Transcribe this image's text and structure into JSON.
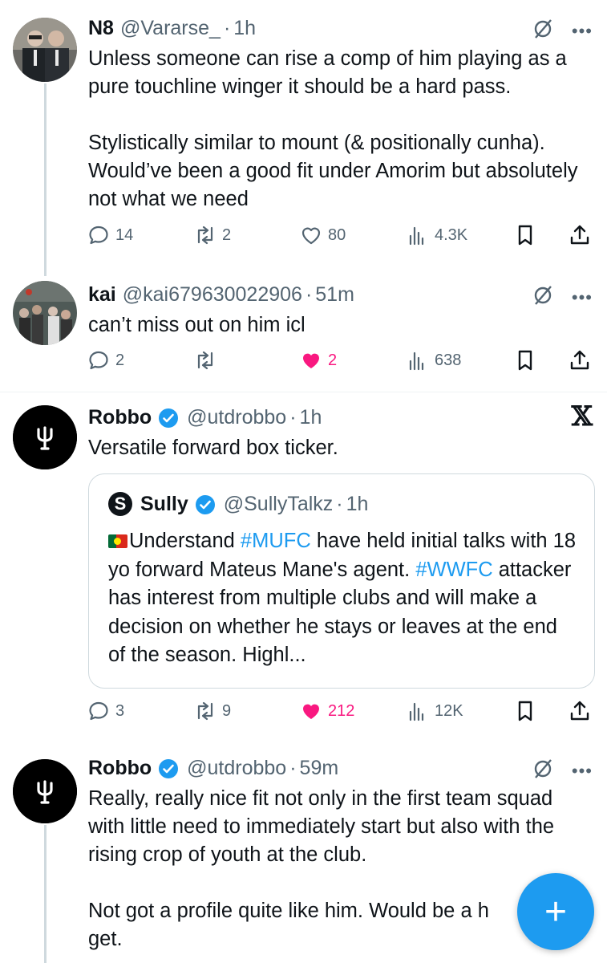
{
  "tweets": [
    {
      "name": "N8",
      "handle": "@Vararse_",
      "dot": "·",
      "time": "1h",
      "paragraphs": [
        "Unless someone can rise a comp of him playing as a pure touchline winger it should be a hard pass.",
        "Stylistically similar to mount (& positionally cunha). Would’ve been a good fit under Amorim but absolutely not what we need"
      ],
      "replies": "14",
      "retweets": "2",
      "likes": "80",
      "views": "4.3K"
    },
    {
      "name": "kai",
      "handle": "@kai679630022906",
      "dot": "·",
      "time": "51m",
      "paragraphs": [
        "can’t miss out on him icl"
      ],
      "replies": "2",
      "retweets": "",
      "likes": "2",
      "views": "638"
    },
    {
      "name": "Robbo",
      "handle": "@utdrobbo",
      "dot": "·",
      "time": "1h",
      "paragraphs": [
        "Versatile forward box ticker."
      ],
      "replies": "3",
      "retweets": "9",
      "likes": "212",
      "views": "12K",
      "quote": {
        "logo_letter": "S",
        "name": "Sully",
        "handle": "@SullyTalkz",
        "dot": "·",
        "time": "1h",
        "text_1": "Understand ",
        "tag_1": "#MUFC",
        "text_2": " have held initial talks with 18 yo forward Mateus Mane's agent. ",
        "tag_2": "#WWFC",
        "text_3": " attacker has interest from multiple clubs and will make a decision on whether he stays or leaves at the end of the season. Highl..."
      }
    },
    {
      "name": "Robbo",
      "handle": "@utdrobbo",
      "dot": "·",
      "time": "59m",
      "paragraphs": [
        "Really, really nice fit not only in the first team squad with little need to immediately start but also with the rising crop of youth at the club.",
        "Not got a profile quite like him. Would be a h get."
      ]
    }
  ],
  "more_label": "•••",
  "x_logo": "𝕏",
  "fab_label": "+",
  "colors": {
    "accent": "#1d9bf0",
    "like": "#f91880",
    "muted": "#536471"
  }
}
